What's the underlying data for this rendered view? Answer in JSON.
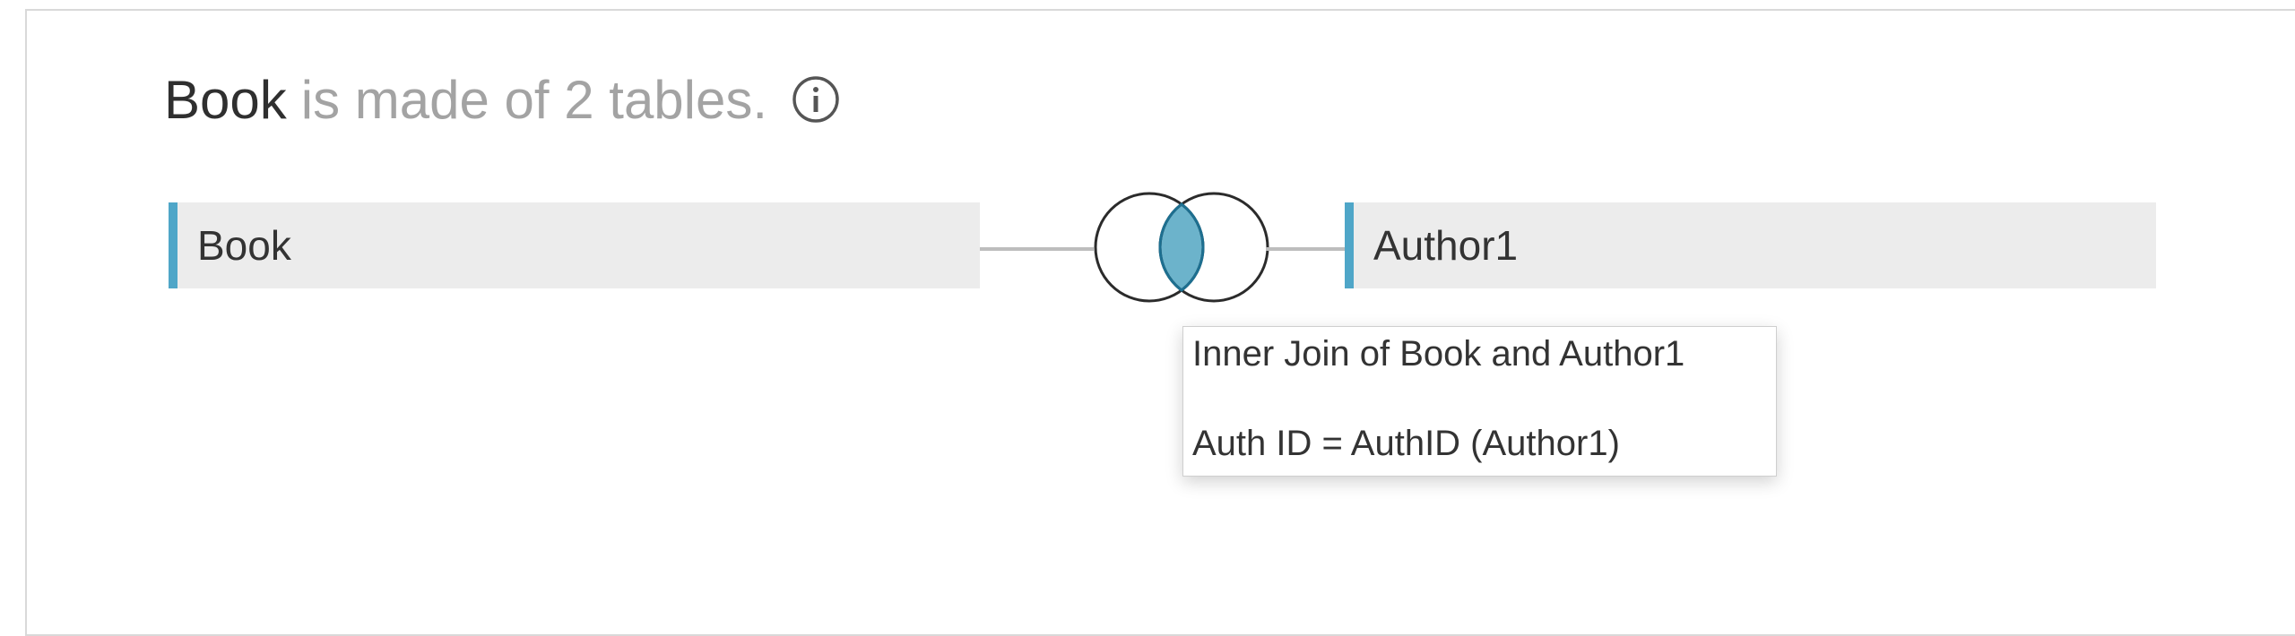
{
  "heading": {
    "name": "Book",
    "rest": "is made of 2 tables.",
    "info_icon": "info-circle-icon"
  },
  "tables": {
    "left": {
      "label": "Book"
    },
    "right": {
      "label": "Author1"
    }
  },
  "join": {
    "type": "inner",
    "icon": "inner-join-venn-icon",
    "accent_color": "#6cb3cb",
    "tooltip": {
      "title": "Inner Join of Book and Author1",
      "clause": "Auth ID = AuthID (Author1)"
    }
  },
  "colors": {
    "table_accent": "#4fa6c8",
    "table_bg": "#ececec",
    "muted_text": "#a3a3a3"
  }
}
